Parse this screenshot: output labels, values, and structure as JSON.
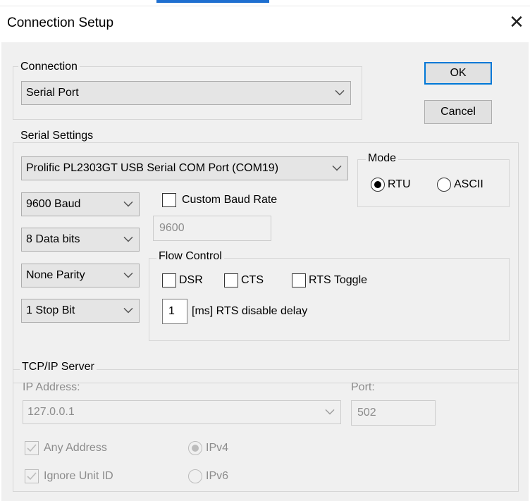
{
  "window": {
    "title": "Connection Setup",
    "close_glyph": "✕"
  },
  "connection": {
    "group_label": "Connection",
    "type_selected": "Serial Port"
  },
  "buttons": {
    "ok": "OK",
    "cancel": "Cancel"
  },
  "serial": {
    "group_label": "Serial Settings",
    "port_selected": "Prolific PL2303GT USB Serial COM Port (COM19)",
    "baud_selected": "9600 Baud",
    "databits_selected": "8 Data bits",
    "parity_selected": "None Parity",
    "stopbits_selected": "1 Stop Bit",
    "custom_baud": {
      "label": "Custom Baud Rate",
      "checked": false,
      "value": "9600"
    },
    "mode": {
      "label": "Mode",
      "options": [
        {
          "label": "RTU",
          "selected": true
        },
        {
          "label": "ASCII",
          "selected": false
        }
      ]
    },
    "flow_control": {
      "label": "Flow Control",
      "dsr": {
        "label": "DSR",
        "checked": false
      },
      "cts": {
        "label": "CTS",
        "checked": false
      },
      "rts_toggle": {
        "label": "RTS Toggle",
        "checked": false
      },
      "rts_delay_value": "1",
      "rts_delay_label": "[ms] RTS disable delay"
    }
  },
  "tcp": {
    "group_label": "TCP/IP Server",
    "ip_label": "IP Address:",
    "ip_value": "127.0.0.1",
    "port_label": "Port:",
    "port_value": "502",
    "any_address": {
      "label": "Any Address",
      "checked": true
    },
    "ignore_unit_id": {
      "label": "Ignore Unit ID",
      "checked": true
    },
    "ipv4": {
      "label": "IPv4",
      "selected": true
    },
    "ipv6": {
      "label": "IPv6",
      "selected": false
    }
  },
  "colors": {
    "accent": "#0078d7",
    "title_accent": "#1e6fd0",
    "background": "#f0f0f0",
    "disabled_text": "#8c8c8c"
  }
}
